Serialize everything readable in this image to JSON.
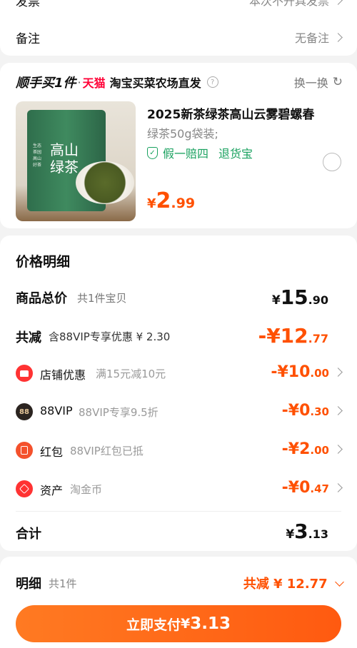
{
  "top": {
    "invoice_label": "发票",
    "invoice_value": "本次不开具发票",
    "remark_label": "备注",
    "remark_value": "无备注"
  },
  "promo": {
    "brand_a": "顺手买1件",
    "dot": "·",
    "brand_b": "天猫",
    "brand_c": "淘宝买菜农场直发",
    "refresh_label": "换一换"
  },
  "product": {
    "name": "2025新茶绿茶高山云雾碧螺春",
    "spec": "绿茶50g袋装;",
    "guarantee_a": "假一赔四",
    "guarantee_b": "退货宝",
    "price_yen": "¥",
    "price_int": "2",
    "price_dec": ".99",
    "image_text": "高山绿茶",
    "image_side": "生态茶园 高山好茶"
  },
  "price_detail": {
    "title": "价格明细",
    "goods_total_label": "商品总价",
    "goods_total_sub": "共1件宝贝",
    "goods_total_int": "15",
    "goods_total_dec": ".90",
    "discount_label": "共减",
    "discount_sub": "含88VIP专享优惠 ¥ 2.30",
    "discount_int": "-¥12",
    "discount_dec": ".77",
    "items": [
      {
        "label": "店铺优惠",
        "sub": "满15元减10元",
        "int": "-¥10",
        "dec": ".00",
        "icon": "shop-icon"
      },
      {
        "label": "88VIP",
        "sub": "88VIP专享9.5折",
        "int": "-¥0",
        "dec": ".30",
        "icon": "88vip-icon",
        "icon_text": "88"
      },
      {
        "label": "红包",
        "sub": "88VIP红包已抵",
        "int": "-¥2",
        "dec": ".00",
        "icon": "red-packet-icon"
      },
      {
        "label": "资产",
        "sub": "淘金币",
        "int": "-¥0",
        "dec": ".47",
        "icon": "coin-tag-icon"
      }
    ],
    "total_label": "合计",
    "total_int": "3",
    "total_dec": ".13"
  },
  "footer": {
    "detail_label": "明细",
    "detail_sub": "共1件",
    "discount_summary": "共减 ¥ 12.77",
    "pay_label": "立即支付",
    "pay_yen": "¥",
    "pay_amount": "3.13"
  },
  "colors": {
    "accent": "#ff5000",
    "green": "#19a15f",
    "tmall_red": "#ff0036"
  }
}
